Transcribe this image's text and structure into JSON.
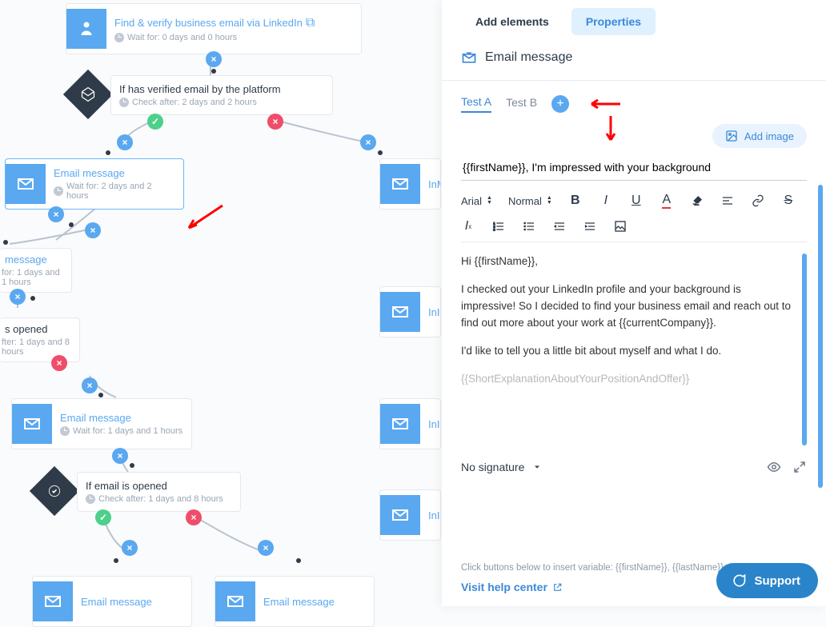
{
  "nodes": {
    "n1": {
      "title": "Find & verify business email via LinkedIn",
      "sub": "Wait for: 0 days and 0 hours"
    },
    "n2": {
      "title": "If has verified email by the platform",
      "sub": "Check after: 2 days and 2 hours"
    },
    "n3": {
      "title": "Email message",
      "sub": "Wait for: 2 days and 2 hours"
    },
    "n4": {
      "title": "InMail message",
      "sub": ""
    },
    "n5": {
      "title": "message",
      "sub": "for: 1 days and 1 hours"
    },
    "n6": {
      "title": "s opened",
      "sub": "fter: 1 days and 8 hours"
    },
    "n7": {
      "title": "Email message",
      "sub": "Wait for: 1 days and 1 hours"
    },
    "n8": {
      "title": "InMail message",
      "sub": ""
    },
    "n9": {
      "title": "If email is opened",
      "sub": "Check after: 1 days and 8 hours"
    },
    "n10": {
      "title": "InMail message",
      "sub": ""
    },
    "n11": {
      "title": "Email message",
      "sub": ""
    },
    "n12": {
      "title": "Email message",
      "sub": ""
    }
  },
  "panel": {
    "tabs": {
      "add": "Add elements",
      "props": "Properties"
    },
    "section": "Email message",
    "tests": {
      "a": "Test A",
      "b": "Test B"
    },
    "add_image": "Add image",
    "subject": "{{firstName}}, I'm impressed with your background",
    "font": "Arial",
    "size": "Normal",
    "body1": "Hi {{firstName}},",
    "body2": "I checked out your LinkedIn profile and your background is impressive! So I decided to find your business email and reach out to find out more about your work at {{currentCompany}}.",
    "body3": "I'd like to tell you a little bit about myself and what I do.",
    "body4": "{{ShortExplanationAboutYourPositionAndOffer}}",
    "signature": "No signature",
    "hint": "Click buttons below to insert variable: {{firstName}}, {{lastName}}, {{companyName}}",
    "help": "Visit help center"
  },
  "support": "Support"
}
